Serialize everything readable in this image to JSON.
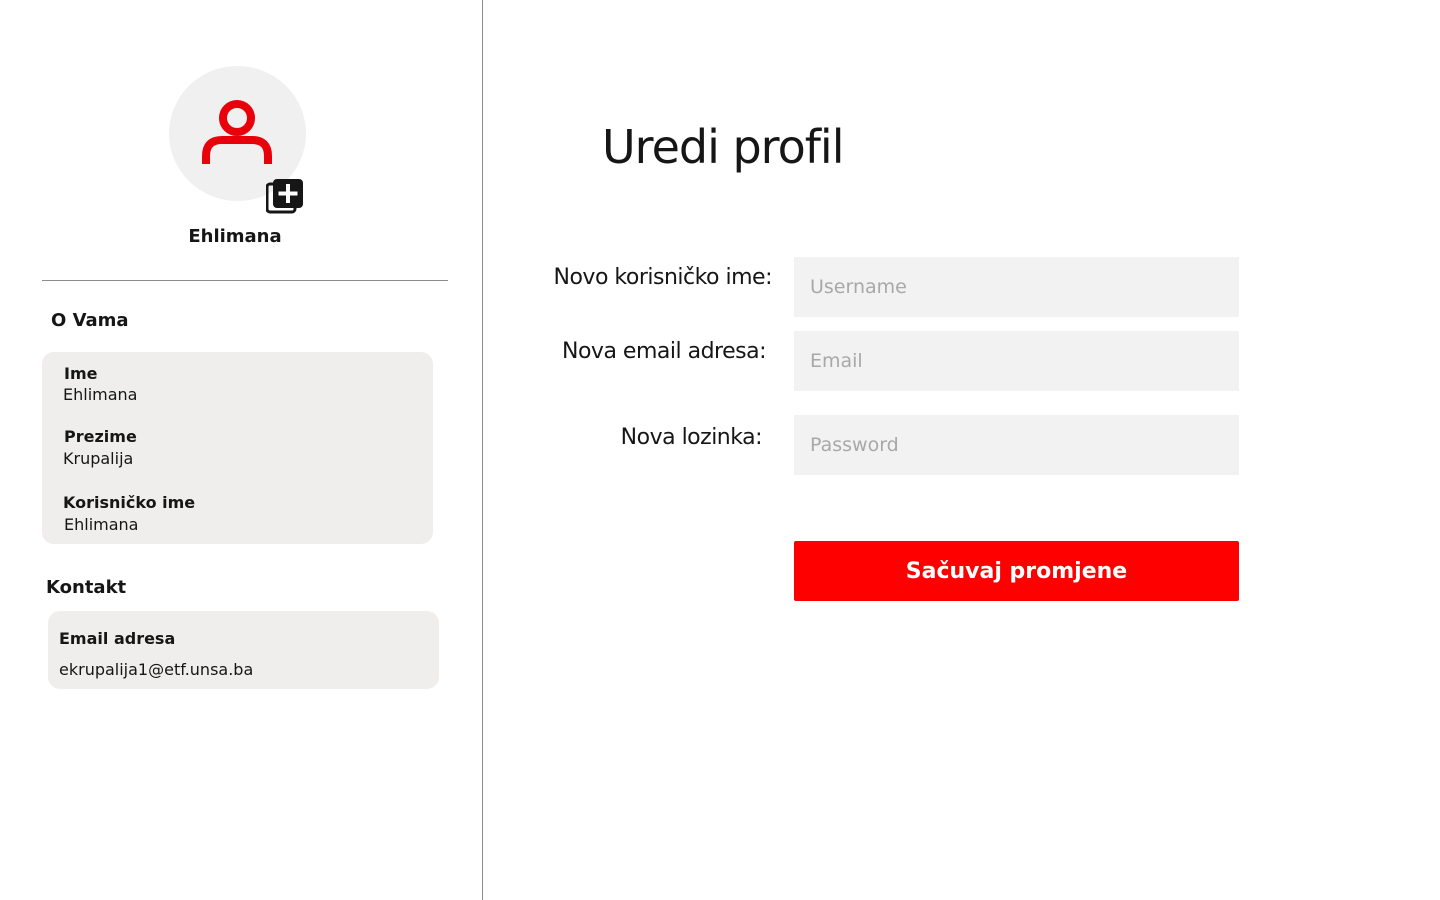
{
  "sidebar": {
    "avatar": {
      "icon": "user-icon",
      "color": "#e8000b"
    },
    "add_photo_icon": "add-box-icon",
    "username": "Ehlimana",
    "about": {
      "title": "O Vama",
      "fields": [
        {
          "label": "Ime",
          "value": "Ehlimana"
        },
        {
          "label": "Prezime",
          "value": "Krupalija"
        },
        {
          "label": "Korisničko ime",
          "value": "Ehlimana"
        }
      ]
    },
    "contact": {
      "title": "Kontakt",
      "fields": [
        {
          "label": "Email adresa",
          "value": "ekrupalija1@etf.unsa.ba"
        }
      ]
    }
  },
  "main": {
    "title": "Uredi profil",
    "form": {
      "username": {
        "label": "Novo korisničko ime:",
        "placeholder": "Username",
        "value": ""
      },
      "email": {
        "label": "Nova email adresa:",
        "placeholder": "Email",
        "value": ""
      },
      "password": {
        "label": "Nova lozinka:",
        "placeholder": "Password",
        "value": ""
      },
      "save_label": "Sačuvaj promjene"
    }
  },
  "colors": {
    "accent": "#ff0000",
    "card_background": "#efeeed",
    "input_background": "#f2f2f2"
  }
}
